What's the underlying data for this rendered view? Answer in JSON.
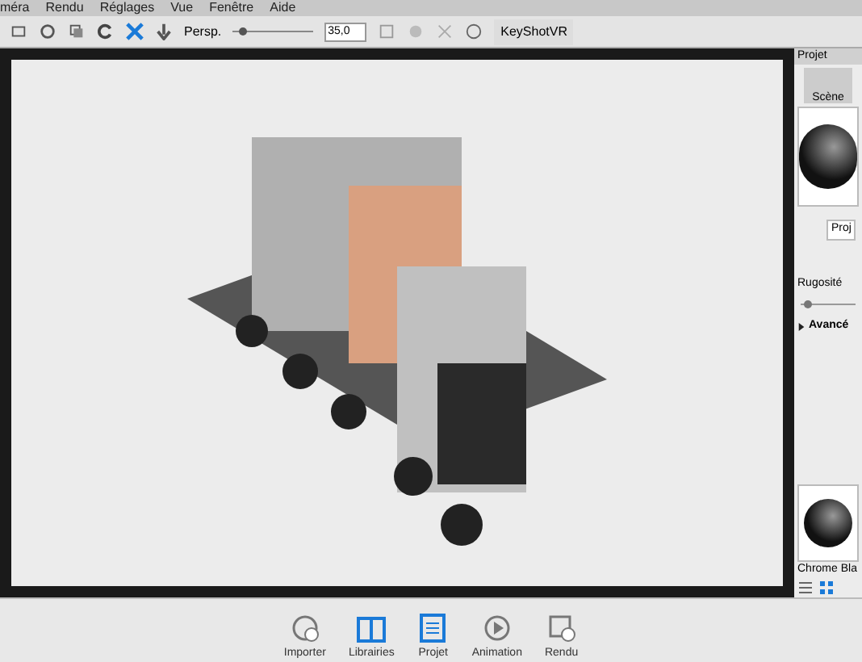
{
  "menu": [
    "méra",
    "Rendu",
    "Réglages",
    "Vue",
    "Fenêtre",
    "Aide"
  ],
  "toolbar": {
    "camera_label": "Persp.",
    "fov": {
      "level": 0.08
    },
    "fov_value": "35,0",
    "vr_button": "KeyShotVR"
  },
  "panel": {
    "title": "Projet",
    "tab": "Scène",
    "subtab": "Proj",
    "roughness": {
      "label": "Rugosité",
      "level": 0.05
    },
    "advanced": {
      "label": "Avancé",
      "expanded": false
    },
    "material": "Chrome Bla",
    "views": [
      {
        "kind": "list",
        "selected": false
      },
      {
        "kind": "grid",
        "selected": true
      }
    ]
  },
  "dock": [
    {
      "kind": "import",
      "label": "Importer",
      "selected": false
    },
    {
      "kind": "library",
      "label": "Librairies",
      "selected": true
    },
    {
      "kind": "project",
      "label": "Projet",
      "selected": true
    },
    {
      "kind": "animation",
      "label": "Animation",
      "selected": false
    },
    {
      "kind": "render",
      "label": "Rendu",
      "selected": false
    }
  ]
}
